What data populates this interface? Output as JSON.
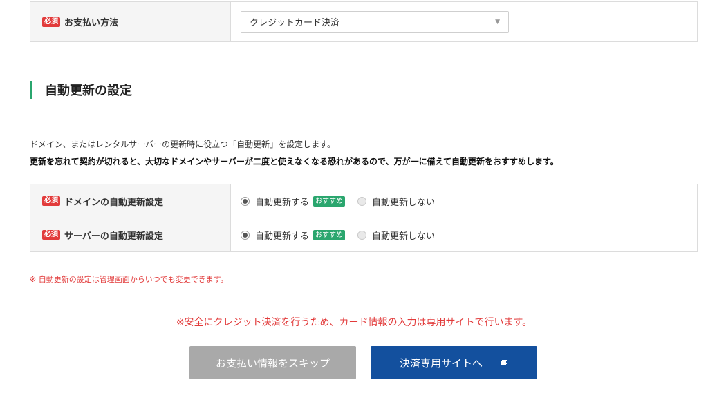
{
  "required_badge": "必須",
  "payment": {
    "label": "お支払い方法",
    "selected_method": "クレジットカード決済"
  },
  "auto_renew": {
    "title": "自動更新の設定",
    "description": "ドメイン、またはレンタルサーバーの更新時に役立つ「自動更新」を設定します。",
    "warning": "更新を忘れて契約が切れると、大切なドメインやサーバーが二度と使えなくなる恐れがあるので、万が一に備えて自動更新をおすすめします。",
    "rows": [
      {
        "label": "ドメインの自動更新設定",
        "option_on": "自動更新する",
        "recommend": "おすすめ",
        "option_off": "自動更新しない",
        "selected": "on"
      },
      {
        "label": "サーバーの自動更新設定",
        "option_on": "自動更新する",
        "recommend": "おすすめ",
        "option_off": "自動更新しない",
        "selected": "on"
      }
    ],
    "note": "※ 自動更新の設定は管理画面からいつでも変更できます。"
  },
  "secure_note": "※安全にクレジット決済を行うため、カード情報の入力は専用サイトで行います。",
  "buttons": {
    "skip_label": "お支払い情報をスキップ",
    "pay_site_label": "決済専用サイトへ"
  },
  "colors": {
    "required": "#e23b3b",
    "accent_green": "#2aa66e",
    "primary_blue": "#13509e",
    "skip_gray": "#a9a9a9"
  }
}
